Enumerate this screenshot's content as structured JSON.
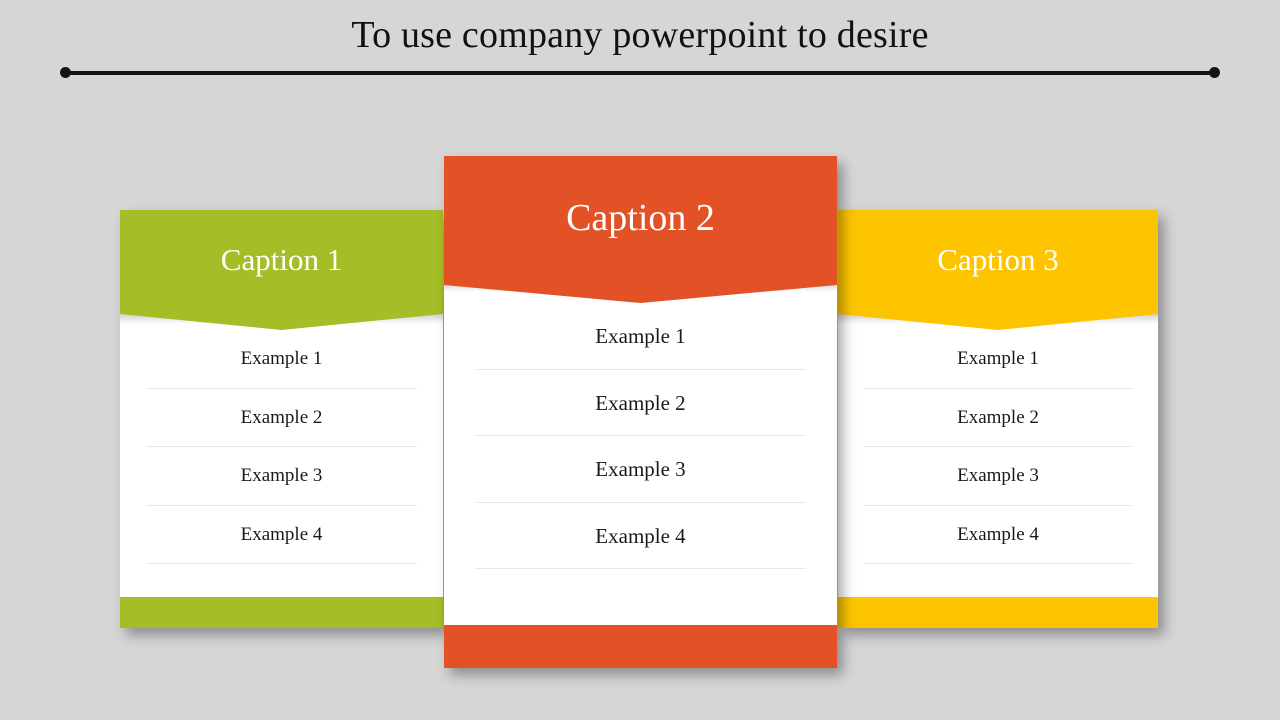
{
  "slide": {
    "title": "To use company powerpoint to desire",
    "background_color": "#d6d6d6",
    "title_color": "#111111",
    "rule_color": "#141414"
  },
  "cards": [
    {
      "caption": "Caption 1",
      "color": "#a5bd26",
      "position": "left",
      "rows": [
        "Example 1",
        "Example 2",
        "Example 3",
        "Example 4"
      ]
    },
    {
      "caption": "Caption 2",
      "color": "#e25226",
      "position": "center",
      "rows": [
        "Example 1",
        "Example 2",
        "Example 3",
        "Example 4"
      ]
    },
    {
      "caption": "Caption 3",
      "color": "#fdc500",
      "position": "right",
      "rows": [
        "Example 1",
        "Example 2",
        "Example 3",
        "Example 4"
      ]
    }
  ]
}
